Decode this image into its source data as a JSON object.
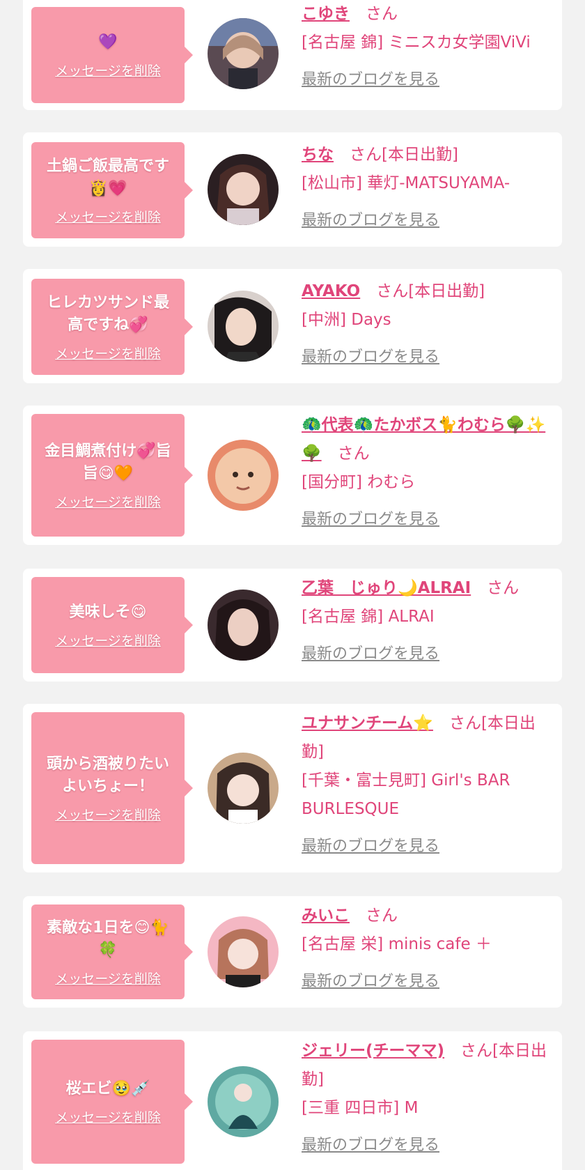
{
  "delete_label": "メッセージを削除",
  "blog_label": "最新のブログを見る",
  "san": "さん",
  "colors": {
    "accent": "#e0457a",
    "bubble": "#f89aaa",
    "background": "#f2f2f2",
    "card": "#ffffff",
    "muted": "#8a8a8a"
  },
  "items": [
    {
      "message": "💜",
      "name": "こゆき",
      "suffix": "さん",
      "shop": "[名古屋 錦] ミニスカ女学園ViVi",
      "avatar_icon": "avatar-photo"
    },
    {
      "message": "土鍋ご飯最高です👸💗",
      "name": "ちな",
      "suffix": "さん[本日出勤]",
      "shop": "[松山市] 華灯-MATSUYAMA-",
      "avatar_icon": "avatar-photo"
    },
    {
      "message": "ヒレカツサンド最高ですね💞",
      "name": "AYAKO",
      "suffix": "さん[本日出勤]",
      "shop": "[中洲] Days",
      "avatar_icon": "avatar-photo"
    },
    {
      "message": "金目鯛煮付け💞旨旨😋🧡",
      "name": "🦚代表🦚たかボス🐈わむら🌳✨🌳",
      "suffix": "さん",
      "shop": "[国分町] わむら",
      "avatar_icon": "avatar-photo"
    },
    {
      "message": "美味しそ😋",
      "name": "乙葉　じゅり🌙ALRAI",
      "suffix": "さん",
      "shop": "[名古屋 錦] ALRAI",
      "avatar_icon": "avatar-photo"
    },
    {
      "message": "頭から酒被りたいよいちょー！",
      "name": "ユナサンチーム⭐",
      "suffix": "さん[本日出勤]",
      "shop": "[千葉・富士見町] Girl's BAR BURLESQUE",
      "avatar_icon": "avatar-photo"
    },
    {
      "message": "素敵な1日を😊🐈🍀",
      "name": "みいこ",
      "suffix": "さん",
      "shop": "[名古屋 栄] minis cafe ＋",
      "avatar_icon": "avatar-photo"
    },
    {
      "message": "桜エビ🥹💉",
      "name": "ジェリー(チーママ)",
      "suffix": "さん[本日出勤]",
      "shop": "[三重 四日市] M",
      "avatar_icon": "avatar-photo"
    }
  ]
}
